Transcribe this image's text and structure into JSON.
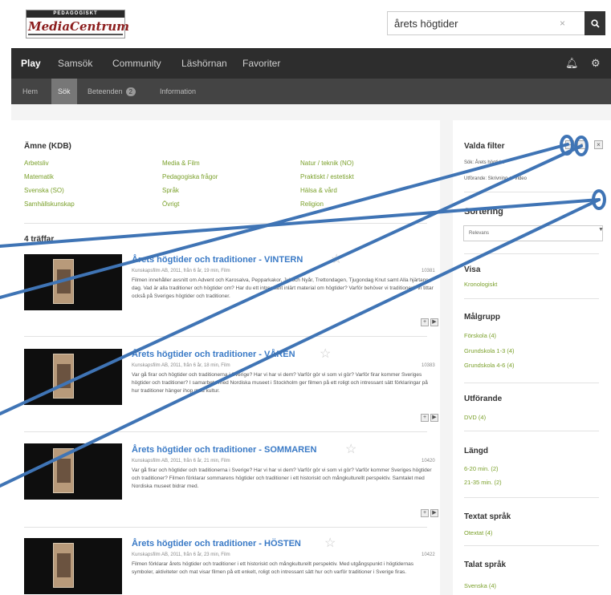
{
  "header": {
    "logo_top": "PEDAGOGISKT",
    "logo_text": "MediaCentrum",
    "search_value": "årets högtider",
    "search_clear": "×"
  },
  "nav": {
    "items": [
      "Play",
      "Samsök",
      "Community",
      "Läshörnan",
      "Favoriter"
    ]
  },
  "subnav": {
    "items": [
      "Hem",
      "Sök",
      "Beteenden",
      "Information"
    ],
    "badge": "2"
  },
  "subjects": {
    "heading": "Ämne (KDB)",
    "items": [
      "Arbetsliv",
      "Matematik",
      "Svenska (SO)",
      "Samhällskunskap",
      "Media & Film",
      "Pedagogiska frågor",
      "Språk",
      "Övrigt",
      "Natur / teknik (NO)",
      "Praktiskt / estetiskt",
      "Hälsa & vård",
      "Religion"
    ]
  },
  "hits": "4 träffar",
  "results": [
    {
      "title": "Årets högtider och traditioner - VINTERN",
      "meta": "Kunskapsfilm AB, 2011, från 6 år, 19 min, Film",
      "code": "10381",
      "desc": "Filmen innehåller avsnitt om Advent och Karosalva, Pepparkakor, Jul och Nyår, Trettondagen, Tjugondag Knut samt Alla hjärtans dag. Vad är alla traditioner och högtider om? Har du ett intressant inlärt material om högtider? Varför behöver vi traditioner? Vi tittar också på Sveriges högtider och traditioner."
    },
    {
      "title": "Årets högtider och traditioner - VÅREN",
      "meta": "Kunskapsfilm AB, 2011, från 6 år, 18 min, Film",
      "code": "10383",
      "desc": "Var gå firar och högtider och traditionerna i Sverige? Har vi har vi dem? Varför gör vi som vi gör? Varför firar kommer Sveriges högtider och traditioner? I samarbete med Nordiska museet i Stockholm ger filmen på ett roligt och intressant sätt förklaringar på hur traditioner hänger ihop med kultur."
    },
    {
      "title": "Årets högtider och traditioner - SOMMAREN",
      "meta": "Kunskapsfilm AB, 2011, från 6 år, 21 min, Film",
      "code": "10420",
      "desc": "Var gå firar och högtider och traditionerna i Sverige? Har vi har vi dem? Varför gör vi som vi gör? Varför kommer Sveriges högtider och traditioner? Filmen förklarar sommarens högtider och traditioner i ett historiskt och mångkulturellt perspektiv. Samtalet med Nordiska museet bidrar med."
    },
    {
      "title": "Årets högtider och traditioner - HÖSTEN",
      "meta": "Kunskapsfilm AB, 2011, från 6 år, 23 min, Film",
      "code": "10422",
      "desc": "Filmen förklarar årets högtider och traditioner i ett historiskt och mångkulturellt perspektiv. Med utgångspunkt i högtidernas symboler, aktiviteter och mat visar filmen på ett enkelt, roligt och intressant sätt hur och varför traditioner i Sverige firas."
    }
  ],
  "sidebar": {
    "filters_heading": "Valda filter",
    "filter_rows": [
      "Sök: Årets högtider",
      "Utförande: Skrivning ✕ Video"
    ],
    "sort_heading": "Sortering",
    "sort_value": "Relevans",
    "show_heading": "Visa",
    "show_link": "Kronologiskt",
    "target_heading": "Målgrupp",
    "target_items": [
      "Förskola (4)",
      "Grundskola 1-3 (4)",
      "Grundskola 4-6 (4)"
    ],
    "format_heading": "Utförande",
    "format_items": [
      "DVD (4)"
    ],
    "length_heading": "Längd",
    "length_items": [
      "6-20 min. (2)",
      "21-35 min. (2)"
    ],
    "subtitle_heading": "Textat språk",
    "subtitle_items": [
      "Otextat (4)"
    ],
    "spoken_heading": "Talat språk",
    "spoken_items": [
      "Svenska (4)"
    ]
  },
  "icons": {
    "search": "search-icon",
    "bell": "bell-icon",
    "gear": "gear-icon",
    "star": "star-icon"
  },
  "colors": {
    "nav_dark": "#2d2d2d",
    "link_green": "#7aa02a",
    "title_blue": "#3a7ac6",
    "annotation_blue": "#3f74b5"
  }
}
